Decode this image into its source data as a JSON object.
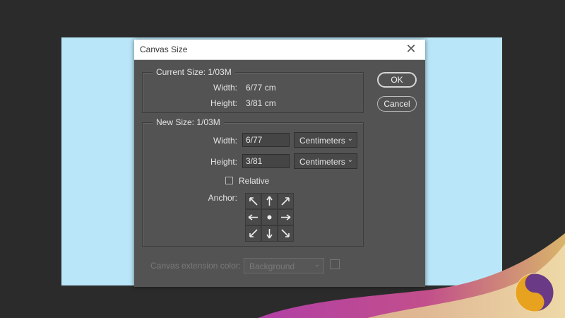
{
  "dialog": {
    "title": "Canvas Size",
    "current_size": {
      "label": "Current Size: 1/03M",
      "width_label": "Width:",
      "width_value": "6/77 cm",
      "height_label": "Height:",
      "height_value": "3/81 cm"
    },
    "new_size": {
      "label": "New Size: 1/03M",
      "width_label": "Width:",
      "width_value": "6/77",
      "width_unit": "Centimeters",
      "height_label": "Height:",
      "height_value": "3/81",
      "height_unit": "Centimeters",
      "relative_label": "Relative",
      "relative_checked": false,
      "anchor_label": "Anchor:"
    },
    "buttons": {
      "ok": "OK",
      "cancel": "Cancel"
    },
    "extension": {
      "label": "Canvas extension color:",
      "value": "Background"
    }
  },
  "colors": {
    "workspace": "#2b2b2b",
    "canvas": "#b9e6f8",
    "dialog_bg": "#535353",
    "titlebar": "#ffffff"
  },
  "icons": {
    "close": "close-icon",
    "dropdown": "chevron-down-icon",
    "anchor_arrows": [
      "arrow-up-left-icon",
      "arrow-up-icon",
      "arrow-up-right-icon",
      "arrow-left-icon",
      "anchor-center-dot-icon",
      "arrow-right-icon",
      "arrow-down-left-icon",
      "arrow-down-icon",
      "arrow-down-right-icon"
    ]
  }
}
